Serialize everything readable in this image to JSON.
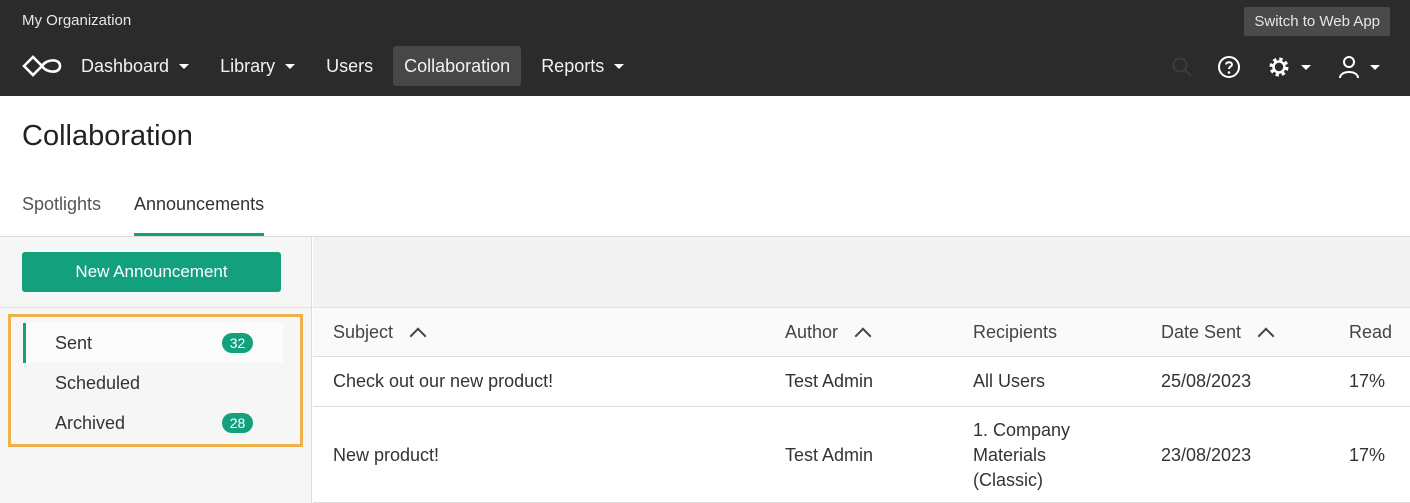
{
  "header": {
    "org_name": "My Organization",
    "switch_label": "Switch to Web App",
    "nav": [
      {
        "label": "Dashboard",
        "dropdown": true
      },
      {
        "label": "Library",
        "dropdown": true
      },
      {
        "label": "Users",
        "dropdown": false
      },
      {
        "label": "Collaboration",
        "dropdown": false,
        "active": true
      },
      {
        "label": "Reports",
        "dropdown": true
      }
    ],
    "icons": [
      "search-icon",
      "help-icon",
      "gear-icon",
      "user-icon"
    ]
  },
  "page": {
    "title": "Collaboration",
    "tabs": [
      {
        "label": "Spotlights",
        "active": false
      },
      {
        "label": "Announcements",
        "active": true
      }
    ]
  },
  "sidebar": {
    "new_button": "New Announcement",
    "folders": [
      {
        "label": "Sent",
        "count": "32",
        "active": true
      },
      {
        "label": "Scheduled",
        "count": "",
        "active": false
      },
      {
        "label": "Archived",
        "count": "28",
        "active": false
      }
    ]
  },
  "table": {
    "columns": [
      "Subject",
      "Author",
      "Recipients",
      "Date Sent",
      "Read"
    ],
    "rows": [
      {
        "subject": "Check out our new product!",
        "author": "Test Admin",
        "recipients": "All Users",
        "date": "25/08/2023",
        "read": "17%"
      },
      {
        "subject": "New product!",
        "author": "Test Admin",
        "recipients": "1. Company Materials (Classic)",
        "date": "23/08/2023",
        "read": "17%"
      }
    ]
  },
  "colors": {
    "accent": "#13a07c",
    "header_bg": "#2b2b2b",
    "highlight_border": "#f0b04a"
  }
}
